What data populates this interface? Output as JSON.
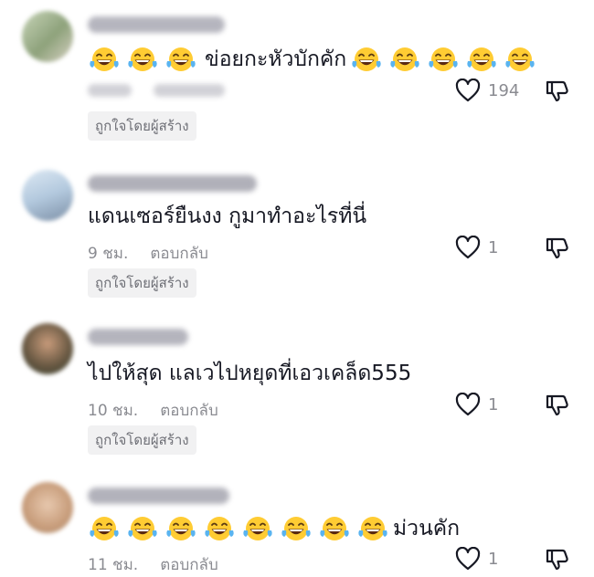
{
  "comments": [
    {
      "text": "ข่อยกะหัวบักคัก",
      "emojis_before": 3,
      "emojis_after": 5,
      "time": "",
      "reply": "",
      "like_count": "194",
      "badge": "ถูกใจโดยผู้สร้าง",
      "avatar_icon": "avatar"
    },
    {
      "text": "แดนเซอร์ยืนงง กูมาทำอะไรที่นี่",
      "emojis_before": 0,
      "emojis_after": 0,
      "time": "9 ชม.",
      "reply": "ตอบกลับ",
      "like_count": "1",
      "badge": "ถูกใจโดยผู้สร้าง",
      "avatar_icon": "avatar"
    },
    {
      "text": "ไปให้สุด แลเวไปหยุดที่เอวเคล็ด555",
      "emojis_before": 0,
      "emojis_after": 0,
      "time": "10 ชม.",
      "reply": "ตอบกลับ",
      "like_count": "1",
      "badge": "ถูกใจโดยผู้สร้าง",
      "avatar_icon": "avatar"
    },
    {
      "text": "ม่วนคัก",
      "emojis_before": 8,
      "emojis_after": 0,
      "time": "11 ชม.",
      "reply": "ตอบกลับ",
      "like_count": "1",
      "badge": "",
      "avatar_icon": "avatar"
    }
  ],
  "icons": {
    "like": "heart-outline-icon",
    "dislike": "thumbs-down-outline-icon",
    "emoji": "face-with-tears-of-joy-icon"
  },
  "colors": {
    "text": "#161823",
    "muted": "#8a8b91",
    "badge_bg": "#f1f1f2"
  }
}
